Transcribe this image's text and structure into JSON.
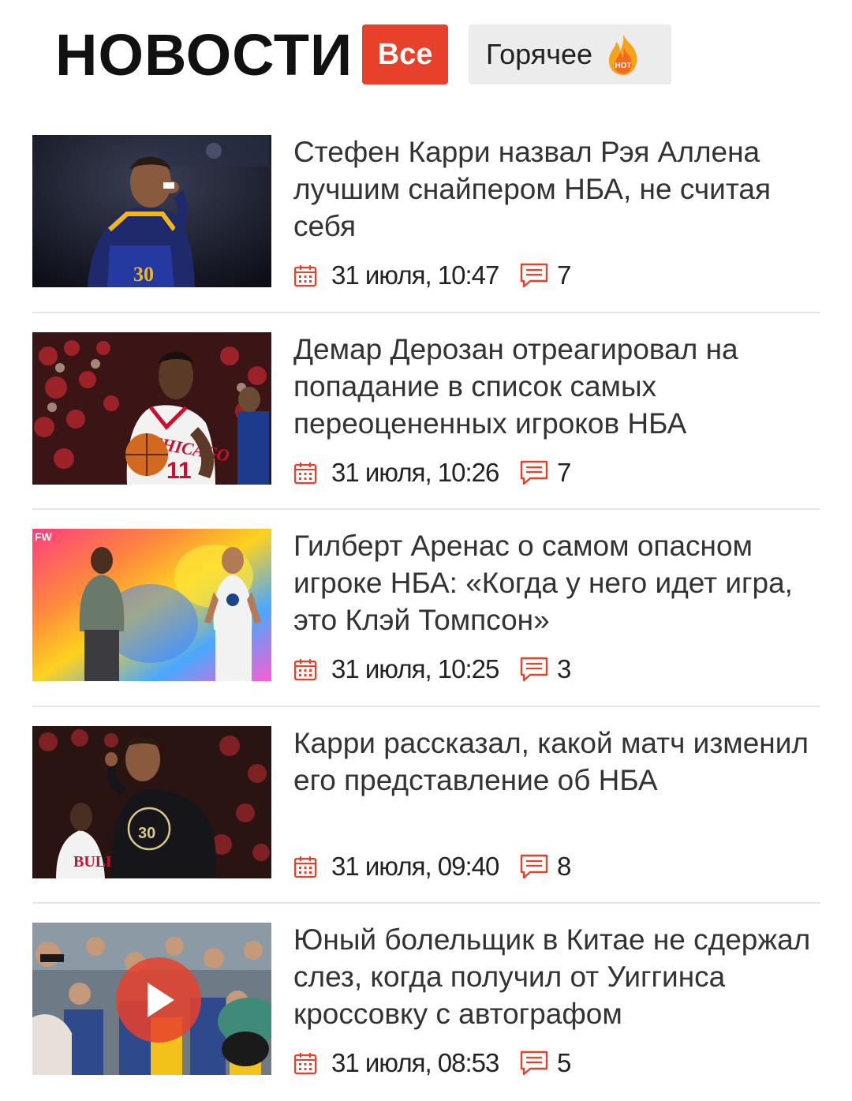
{
  "header": {
    "title": "НОВОСТИ",
    "tabs": [
      {
        "label": "Все",
        "active": true
      },
      {
        "label": "Горячее",
        "active": false,
        "badge_text": "HOT"
      }
    ]
  },
  "colors": {
    "accent": "#e8412b",
    "tab_inactive_bg": "#ececec",
    "divider": "#e6e6e6"
  },
  "news": [
    {
      "headline": "Стефен Карри назвал Рэя Аллена лучшим снайпером НБА, не считая себя",
      "date": "31 июля, 10:47",
      "comments": "7"
    },
    {
      "headline": "Демар Дерозан отреагировал на попадание в список самых переоцененных игроков НБА",
      "date": "31 июля, 10:26",
      "comments": "7"
    },
    {
      "headline": "Гилберт Аренас о самом опасном игроке НБА: «Когда у него идет игра, это Клэй Томпсон»",
      "date": "31 июля, 10:25",
      "comments": "3",
      "thumb_badge": "FW"
    },
    {
      "headline": "Карри рассказал, какой матч изменил его представление об НБА",
      "date": "31 июля, 09:40",
      "comments": "8"
    },
    {
      "headline": "Юный болельщик в Китае не сдержал слез, когда получил от Уиггинса кроссовку с автографом",
      "date": "31 июля, 08:53",
      "comments": "5",
      "is_video": true
    }
  ],
  "icons": {
    "calendar": "calendar-icon",
    "comments": "comment-icon",
    "hot": "fire-icon",
    "video": "play-icon"
  }
}
